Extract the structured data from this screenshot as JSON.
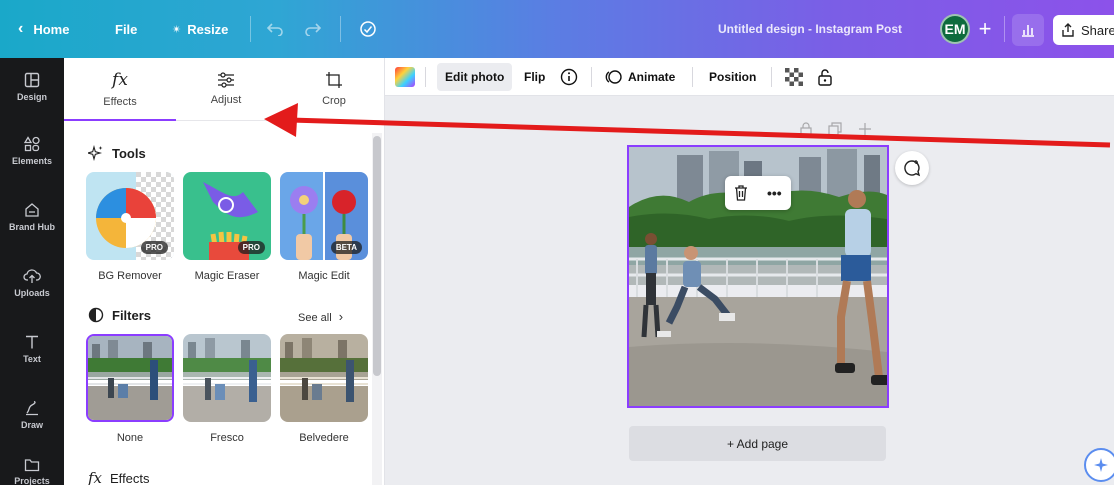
{
  "topbar": {
    "home_label": "Home",
    "file_label": "File",
    "resize_label": "Resize",
    "design_title": "Untitled design - Instagram Post",
    "avatar_initials": "EM",
    "share_label": "Share"
  },
  "rail": {
    "items": [
      {
        "label": "Design",
        "icon": "layout-icon"
      },
      {
        "label": "Elements",
        "icon": "shapes-icon"
      },
      {
        "label": "Brand Hub",
        "icon": "brand-hub-icon"
      },
      {
        "label": "Uploads",
        "icon": "upload-cloud-icon"
      },
      {
        "label": "Text",
        "icon": "text-icon"
      },
      {
        "label": "Draw",
        "icon": "draw-icon"
      },
      {
        "label": "Projects",
        "icon": "folder-icon"
      }
    ]
  },
  "panel": {
    "tabs": [
      {
        "label": "Effects",
        "icon": "fx-icon"
      },
      {
        "label": "Adjust",
        "icon": "sliders-icon"
      },
      {
        "label": "Crop",
        "icon": "crop-icon"
      }
    ],
    "active_tab": "Effects",
    "tools": {
      "heading": "Tools",
      "items": [
        {
          "label": "BG Remover",
          "badge": "PRO"
        },
        {
          "label": "Magic Eraser",
          "badge": "PRO"
        },
        {
          "label": "Magic Edit",
          "badge": "BETA"
        }
      ]
    },
    "filters": {
      "heading": "Filters",
      "see_all": "See all",
      "items": [
        {
          "label": "None"
        },
        {
          "label": "Fresco"
        },
        {
          "label": "Belvedere"
        }
      ]
    },
    "effects": {
      "heading": "Effects"
    }
  },
  "toolbar": {
    "edit_photo": "Edit photo",
    "flip": "Flip",
    "animate": "Animate",
    "position": "Position"
  },
  "canvas": {
    "photo_more": "•••",
    "add_page": "+ Add page"
  },
  "colors": {
    "accent": "#8b3dff",
    "rail_bg": "#18191b",
    "annotation_arrow": "#e31b1b"
  }
}
